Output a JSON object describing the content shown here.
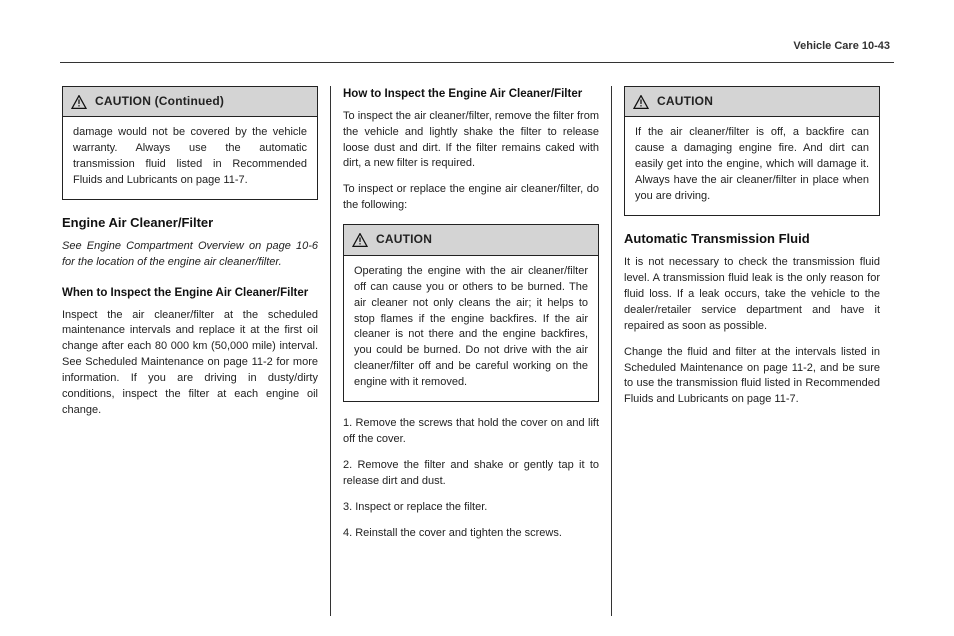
{
  "header": {
    "running_head": "Vehicle Care    10-43"
  },
  "col1": {
    "continued_label": "CAUTION (Continued)",
    "continued_body": "damage would not be covered by the vehicle warranty. Always use the automatic transmission fluid listed in Recommended Fluids and Lubricants on page 11-7.",
    "heading": "Engine Air Cleaner/Filter",
    "p1": "See Engine Compartment Overview on page 10-6 for the location of the engine air cleaner/filter.",
    "subhead": "When to Inspect the Engine Air Cleaner/Filter",
    "p2": "Inspect the air cleaner/filter at the scheduled maintenance intervals and replace it at the first oil change after each 80 000 km (50,000 mile) interval. See Scheduled Maintenance on page 11-2 for more information. If you are driving in dusty/dirty conditions, inspect the filter at each engine oil change."
  },
  "col2": {
    "subhead": "How to Inspect the Engine Air Cleaner/Filter",
    "p1": "To inspect the air cleaner/filter, remove the filter from the vehicle and lightly shake the filter to release loose dust and dirt. If the filter remains caked with dirt, a new filter is required.",
    "p2": "To inspect or replace the engine air cleaner/filter, do the following:",
    "caution_label": "CAUTION",
    "caution_body": "Operating the engine with the air cleaner/filter off can cause you or others to be burned. The air cleaner not only cleans the air; it helps to stop flames if the engine backfires. If the air cleaner is not there and the engine backfires, you could be burned. Do not drive with the air cleaner/filter off and be careful working on the engine with it removed.",
    "p3": "1. Remove the screws that hold the cover on and lift off the cover.",
    "p4": "2. Remove the filter and shake or gently tap it to release dirt and dust.",
    "p5": "3. Inspect or replace the filter.",
    "p6": "4. Reinstall the cover and tighten the screws."
  },
  "col3": {
    "caution_label": "CAUTION",
    "caution_body": "If the air cleaner/filter is off, a backfire can cause a damaging engine fire. And dirt can easily get into the engine, which will damage it. Always have the air cleaner/filter in place when you are driving.",
    "heading": "Automatic Transmission Fluid",
    "p1": "It is not necessary to check the transmission fluid level. A transmission fluid leak is the only reason for fluid loss. If a leak occurs, take the vehicle to the dealer/retailer service department and have it repaired as soon as possible.",
    "p2": "Change the fluid and filter at the intervals listed in Scheduled Maintenance on page 11-2, and be sure to use the transmission fluid listed in Recommended Fluids and Lubricants on page 11-7."
  }
}
